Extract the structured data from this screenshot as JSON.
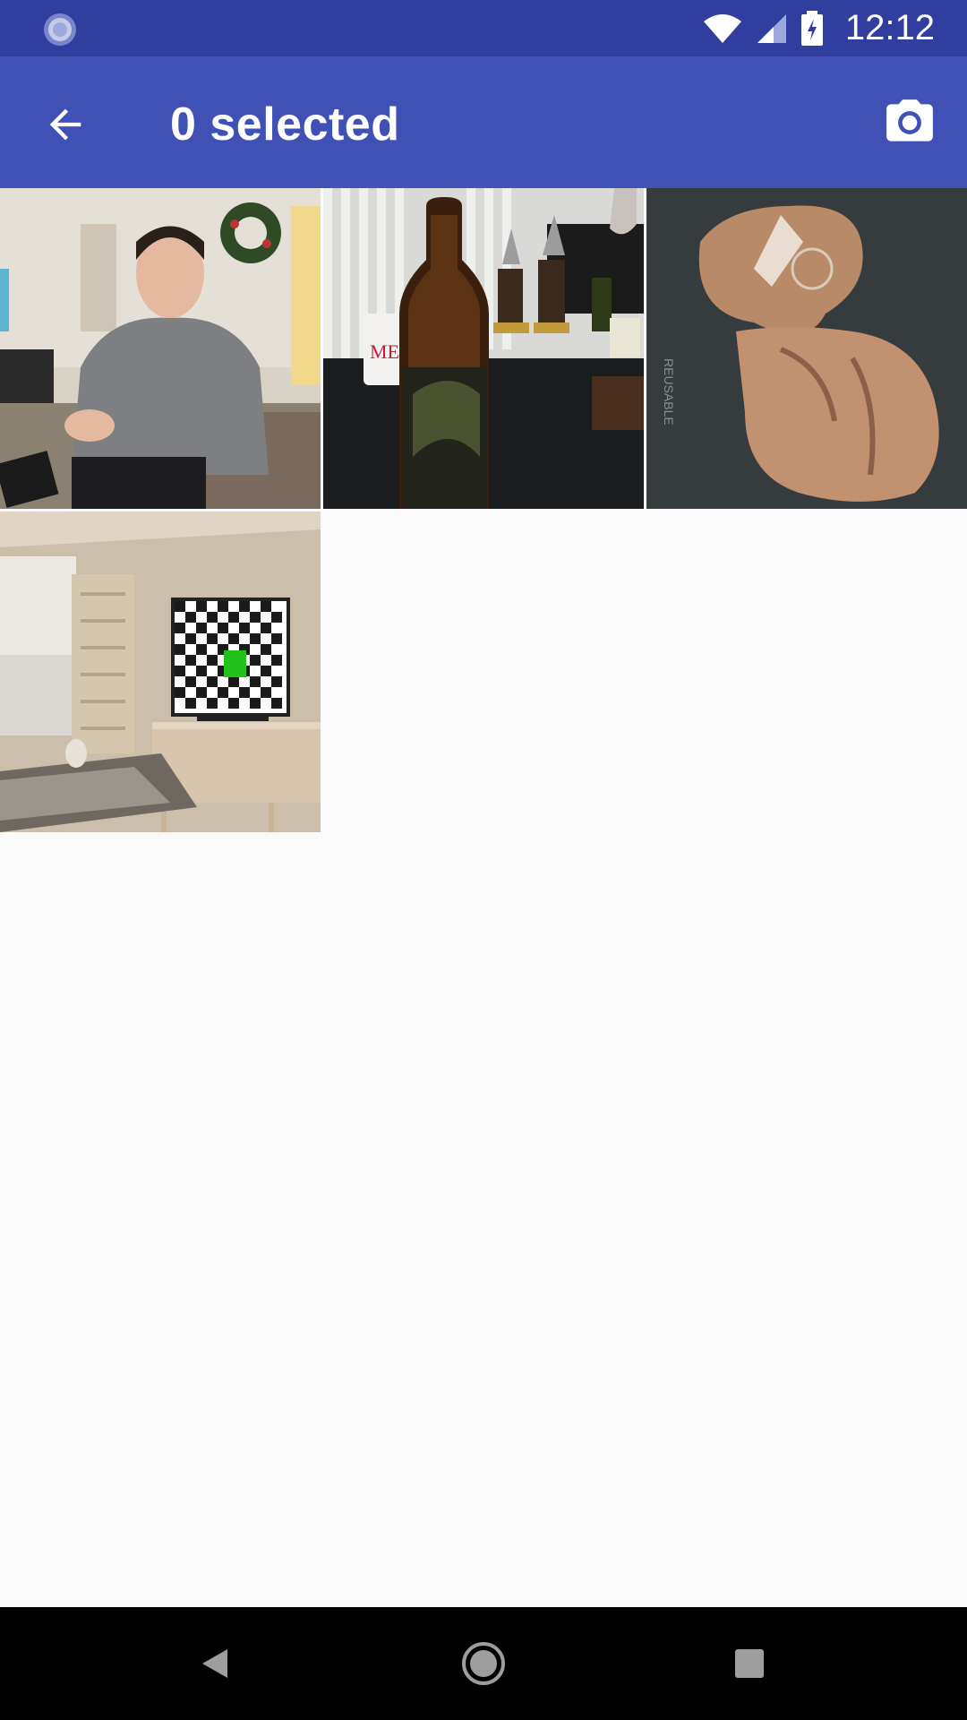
{
  "status_bar": {
    "time": "12:12",
    "left_icon": "sync-icon",
    "icons": [
      "wifi-icon",
      "signal-icon",
      "battery-charging-icon"
    ]
  },
  "app_bar": {
    "title": "0 selected",
    "back_icon": "arrow-back-icon",
    "camera_icon": "camera-icon",
    "color": "#3f51b5",
    "status_color": "#303f9f"
  },
  "photos": [
    {
      "name": "photo-person-living-room",
      "mug_text": ""
    },
    {
      "name": "photo-bottle-table",
      "mug_text": "MERRY"
    },
    {
      "name": "photo-pastry-container",
      "container_text": "REUSABLE"
    },
    {
      "name": "photo-room-tv-checkerboard",
      "mug_text": ""
    }
  ],
  "nav_bar": {
    "icons": [
      "nav-back-icon",
      "nav-home-icon",
      "nav-recents-icon"
    ]
  }
}
